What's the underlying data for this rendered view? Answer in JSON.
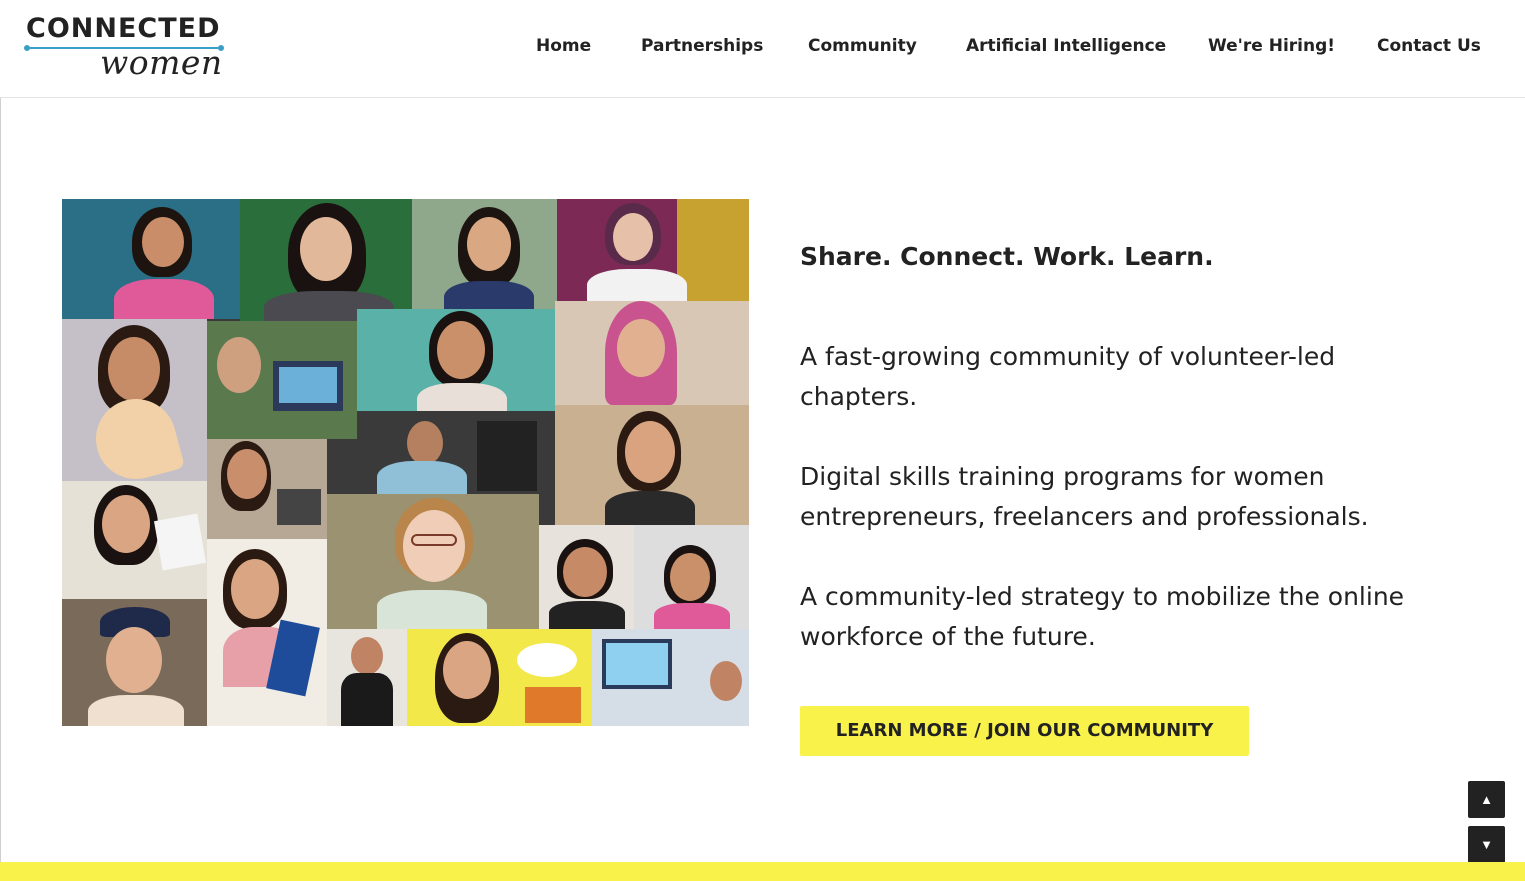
{
  "brand": {
    "logo_top": "CONNECTED",
    "logo_bottom": "women",
    "accent_color": "#3aa0c8"
  },
  "nav": {
    "items": [
      {
        "label": "Home"
      },
      {
        "label": "Partnerships"
      },
      {
        "label": "Community"
      },
      {
        "label": "Artificial Intelligence"
      },
      {
        "label": "We're Hiring!"
      },
      {
        "label": "Contact Us"
      }
    ]
  },
  "hero": {
    "image": "collage of video-call participants",
    "tagline": "Share. Connect. Work. Learn.",
    "paragraphs": [
      "A fast-growing community of volunteer-led chapters.",
      "Digital skills training programs for women entrepreneurs, freelancers and professionals.",
      "A community-led strategy to mobilize the online workforce of the future."
    ],
    "cta_label": "LEARN MORE / JOIN OUR COMMUNITY",
    "cta_color": "#f9f24a"
  },
  "scroll": {
    "up_icon": "▲",
    "down_icon": "▼"
  }
}
